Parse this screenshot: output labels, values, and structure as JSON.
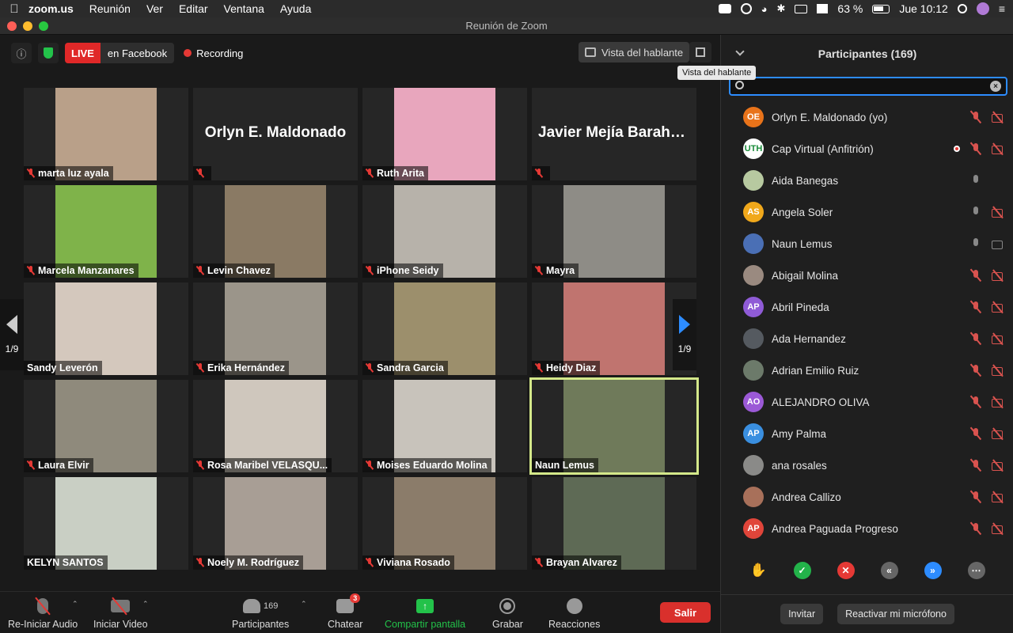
{
  "menubar": {
    "app": "zoom.us",
    "items": [
      "Reunión",
      "Ver",
      "Editar",
      "Ventana",
      "Ayuda"
    ],
    "battery": "63 %",
    "clock": "Jue 10:12"
  },
  "window": {
    "title": "Reunión de Zoom"
  },
  "topbar": {
    "live_label": "LIVE",
    "live_target": "en Facebook",
    "recording_label": "Recording",
    "view_button": "Vista del hablante",
    "tooltip": "Vista del hablante"
  },
  "tiles": [
    {
      "name": "marta luz ayala",
      "video": true,
      "muted": true,
      "color": "#b9a089"
    },
    {
      "name": "",
      "big_name": "Orlyn E. Maldonado",
      "video": false,
      "muted": true
    },
    {
      "name": "Ruth Arita",
      "video": true,
      "muted": true,
      "color": "#e8a6bd"
    },
    {
      "name": "",
      "big_name": "Javier Mejía Baraho...",
      "video": false,
      "muted": true
    },
    {
      "name": "Marcela Manzanares",
      "video": true,
      "muted": true,
      "color": "#7fb34a"
    },
    {
      "name": "Levin Chavez",
      "video": true,
      "muted": true,
      "color": "#8a7a64"
    },
    {
      "name": "iPhone Seidy",
      "video": true,
      "muted": true,
      "color": "#b7b2aa"
    },
    {
      "name": "Mayra",
      "video": true,
      "muted": true,
      "color": "#8e8c86"
    },
    {
      "name": "Sandy Leverón",
      "video": true,
      "muted": false,
      "color": "#d4c8bd"
    },
    {
      "name": "Erika Hernández",
      "video": true,
      "muted": true,
      "color": "#9b958a"
    },
    {
      "name": "Sandra Garcia",
      "video": true,
      "muted": true,
      "color": "#9c8f6c"
    },
    {
      "name": "Heidy Diaz",
      "video": true,
      "muted": true,
      "color": "#c0746f"
    },
    {
      "name": "Laura Elvir",
      "video": true,
      "muted": true,
      "color": "#8f8a7c"
    },
    {
      "name": "Rosa Maribel VELASQU...",
      "video": true,
      "muted": true,
      "color": "#cfc7bd"
    },
    {
      "name": "Moises Eduardo Molina",
      "video": true,
      "muted": true,
      "color": "#c8c3bb"
    },
    {
      "name": "Naun Lemus",
      "video": true,
      "muted": false,
      "active": true,
      "color": "#6f7a5a"
    },
    {
      "name": "KELYN SANTOS",
      "video": true,
      "muted": false,
      "color": "#c9cfc4"
    },
    {
      "name": "Noely M. Rodríguez",
      "video": true,
      "muted": true,
      "color": "#a89e95"
    },
    {
      "name": "Viviana Rosado",
      "video": true,
      "muted": true,
      "color": "#8b7c6a"
    },
    {
      "name": "Brayan Alvarez",
      "video": true,
      "muted": true,
      "color": "#5e6a55"
    }
  ],
  "pager": {
    "left": "1/9",
    "right": "1/9"
  },
  "toolbar": {
    "audio": "Re-Iniciar Audio",
    "video": "Iniciar Video",
    "participants": "Participantes",
    "participants_count": "169",
    "chat": "Chatear",
    "chat_badge": "3",
    "share": "Compartir pantalla",
    "record": "Grabar",
    "reactions": "Reacciones",
    "leave": "Salir"
  },
  "panel": {
    "title": "Participantes (169)",
    "participants": [
      {
        "name": "Orlyn E. Maldonado (yo)",
        "initials": "OE",
        "color": "#e8731a",
        "mic": "off",
        "cam": "off"
      },
      {
        "name": "Cap Virtual (Anfitrión)",
        "initials": "UTH",
        "color": "#ffffff",
        "mic": "off",
        "cam": "off",
        "recording": true
      },
      {
        "name": "Aida Banegas",
        "initials": "",
        "color": "#b7c9a0",
        "mic": "on",
        "cam": "none"
      },
      {
        "name": "Angela Soler",
        "initials": "AS",
        "color": "#f0a81b",
        "mic": "on",
        "cam": "off"
      },
      {
        "name": "Naun Lemus",
        "initials": "",
        "color": "#4a6fb5",
        "mic": "on",
        "cam": "on"
      },
      {
        "name": "Abigail Molina",
        "initials": "",
        "color": "#9a8a80",
        "mic": "off",
        "cam": "off"
      },
      {
        "name": "Abril Pineda",
        "initials": "AP",
        "color": "#8f5bd6",
        "mic": "off",
        "cam": "off"
      },
      {
        "name": "Ada Hernandez",
        "initials": "",
        "color": "#555a60",
        "mic": "off",
        "cam": "off"
      },
      {
        "name": "Adrian Emilio Ruiz",
        "initials": "",
        "color": "#6c7a6a",
        "mic": "off",
        "cam": "off"
      },
      {
        "name": "ALEJANDRO OLIVA",
        "initials": "AO",
        "color": "#9b59d6",
        "mic": "off",
        "cam": "off"
      },
      {
        "name": "Amy Palma",
        "initials": "AP",
        "color": "#3a8fe0",
        "mic": "off",
        "cam": "off"
      },
      {
        "name": "ana rosales",
        "initials": "",
        "color": "#8a8a88",
        "mic": "off",
        "cam": "off"
      },
      {
        "name": "Andrea Callizo",
        "initials": "",
        "color": "#a8705a",
        "mic": "off",
        "cam": "off"
      },
      {
        "name": "Andrea Paguada Progreso",
        "initials": "AP",
        "color": "#e0453a",
        "mic": "off",
        "cam": "off"
      }
    ],
    "invite": "Invitar",
    "unmute": "Reactivar mi micrófono"
  },
  "colors": {
    "live_red": "#e02828",
    "accent_blue": "#2d8cff",
    "leave_red": "#d9302c",
    "share_green": "#23c24a",
    "active_speaker": "#d4e88a"
  }
}
